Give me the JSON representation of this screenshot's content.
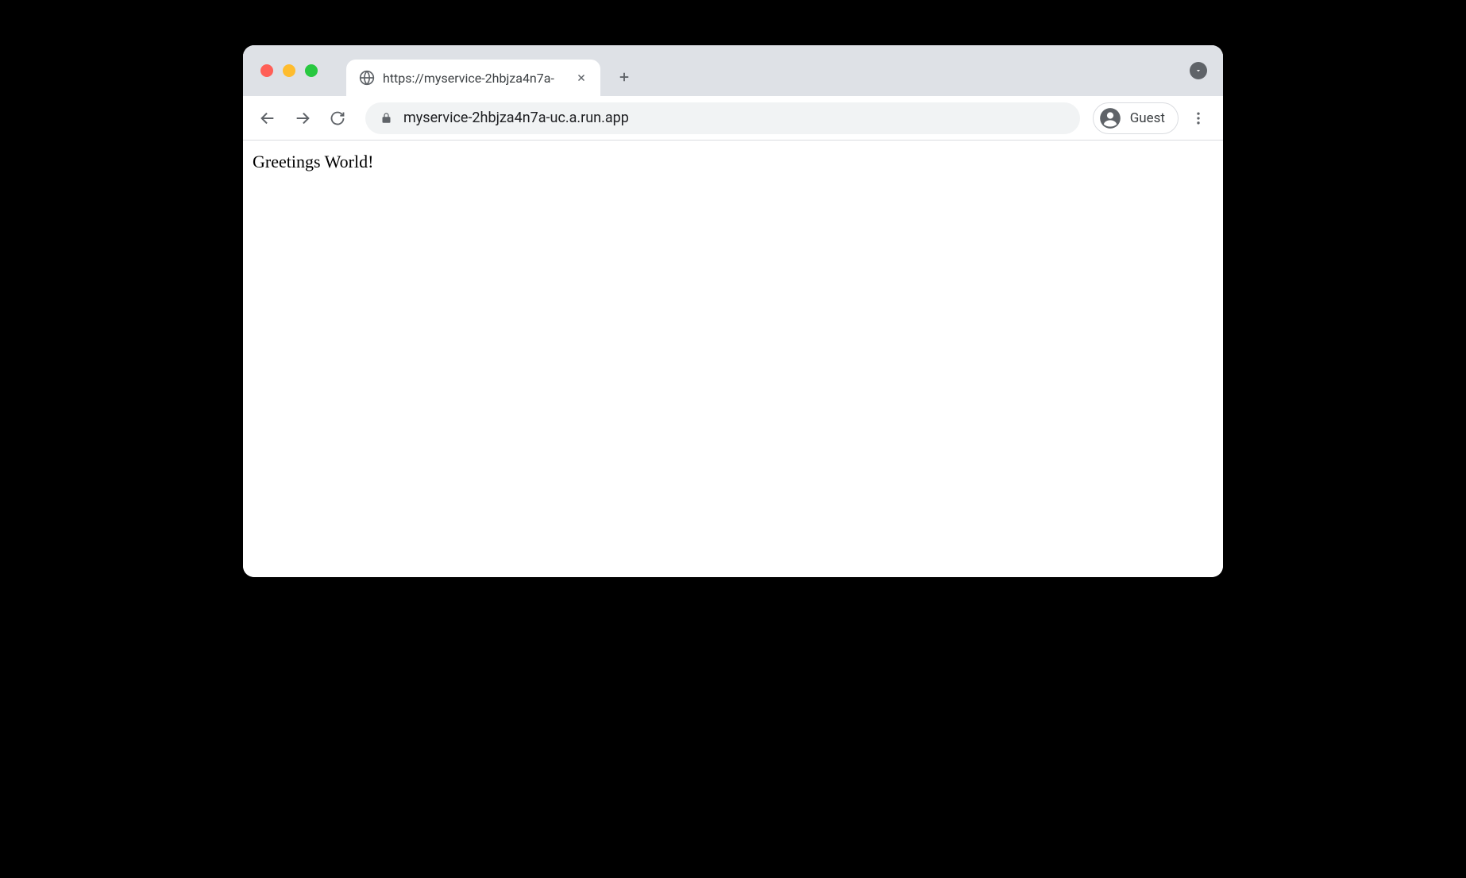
{
  "tab": {
    "title": "https://myservice-2hbjza4n7a-"
  },
  "address_bar": {
    "url": "myservice-2hbjza4n7a-uc.a.run.app"
  },
  "profile": {
    "label": "Guest"
  },
  "page": {
    "body_text": "Greetings World!"
  }
}
